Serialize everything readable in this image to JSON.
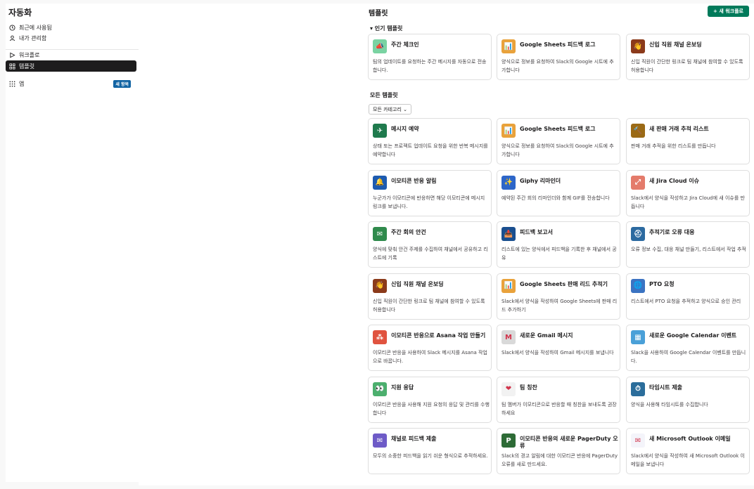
{
  "sidebar": {
    "title": "자동화",
    "recent_label": "최근에 사용됨",
    "managed_label": "내가 관리함",
    "workflows_label": "워크플로",
    "templates_label": "템플릿",
    "apps_label": "앱",
    "new_badge": "새 항목"
  },
  "header": {
    "title": "템플릿",
    "new_workflow_label": "+ 새 워크플로"
  },
  "popular": {
    "heading": "▾ 인기 템플릿",
    "cards": [
      {
        "title": "주간 체크인",
        "desc": "팀의 업데이트를 요청하는 주간 메시지를 자동으로 전송합니다.",
        "icon": "megaphone-icon",
        "color": "#7ad3a2",
        "glyph": "📣"
      },
      {
        "title": "Google Sheets 피드백 로그",
        "desc": "양식으로 정보를 요청하여 Slack의 Google 시트에 추가합니다",
        "icon": "sheets-icon",
        "color": "#e9a23b",
        "glyph": "📊"
      },
      {
        "title": "신입 직원 채널 온보딩",
        "desc": "신입 직원이 간단한 링크로 팀 채널에 참여할 수 있도록 허용합니다",
        "icon": "wave-icon",
        "color": "#8b3a1a",
        "glyph": "👋"
      }
    ]
  },
  "all": {
    "heading": "모든 템플릿",
    "filter_label": "모든 카테고리 ⌄",
    "cards": [
      {
        "title": "메시지 예약",
        "desc": "상태 또는 프로젝트 업데이트 요청을 위한 반복 메시지를 예약합니다",
        "icon": "paper-plane-icon",
        "color": "#1f7a4d",
        "glyph": "✈"
      },
      {
        "title": "Google Sheets 피드백 로그",
        "desc": "양식으로 정보를 요청하여 Slack의 Google 시트에 추가합니다",
        "icon": "sheets-icon",
        "color": "#e9a23b",
        "glyph": "📊"
      },
      {
        "title": "새 판매 거래 추적 리스트",
        "desc": "판매 거래 추적을 위한 리스트를 만듭니다",
        "icon": "gavel-icon",
        "color": "#9b6a16",
        "glyph": "🔨"
      },
      {
        "title": "이모티콘 반응 알림",
        "desc": "누군가가 이모티콘에 반응하면 해당 이모티콘에 메시지 링크를 보냅니다.",
        "icon": "bell-icon",
        "color": "#1d5bb0",
        "glyph": "🔔"
      },
      {
        "title": "Giphy 리마인더",
        "desc": "예약된 주간 회의 리마인더와 함께 GIF를 전송합니다",
        "icon": "giphy-icon",
        "color": "#2d66c9",
        "glyph": "✨"
      },
      {
        "title": "새 Jira Cloud 이슈",
        "desc": "Slack에서 양식을 작성하고 Jira Cloud에 새 이슈를 만듭니다",
        "icon": "jira-icon",
        "color": "#e47b6b",
        "glyph": "⤢"
      },
      {
        "title": "주간 회의 안건",
        "desc": "양식에 맞춰 안건 주제를 수집하여 채널에서 공유하고 리스트에 기록",
        "icon": "note-icon",
        "color": "#2f8a4c",
        "glyph": "✉"
      },
      {
        "title": "피드백 보고서",
        "desc": "리스트에 있는 양식에서 피드백을 기록한 후 채널에서 공유",
        "icon": "inbox-icon",
        "color": "#1a4f8f",
        "glyph": "📥"
      },
      {
        "title": "추적기로 오류 대응",
        "desc": "오류 정보 수집, 대응 채널 만들기, 리스트에서 작업 추적",
        "icon": "lifebuoy-icon",
        "color": "#2c6aa0",
        "glyph": "⛑"
      },
      {
        "title": "신입 직원 채널 온보딩",
        "desc": "신입 직원이 간단한 링크로 팀 채널에 참여할 수 있도록 허용합니다",
        "icon": "wave-icon",
        "color": "#8b3a1a",
        "glyph": "👋"
      },
      {
        "title": "Google Sheets 판매 리드 추적기",
        "desc": "Slack에서 양식을 작성하여 Google Sheets에 판매 리드 추가하기",
        "icon": "sheets-icon",
        "color": "#e9a23b",
        "glyph": "📊"
      },
      {
        "title": "PTO 요청",
        "desc": "리스트에서 PTO 요청을 추적하고 양식으로 승인 관리",
        "icon": "globe-icon",
        "color": "#3b73c2",
        "glyph": "🌐"
      },
      {
        "title": "이모티콘 반응으로 Asana 작업 만들기",
        "desc": "이모티콘 반응을 사용하여 Slack 메시지를 Asana 작업으로 바꿉니다.",
        "icon": "asana-icon",
        "color": "#e0533f",
        "glyph": "⁂"
      },
      {
        "title": "새로운 Gmail 메시지",
        "desc": "Slack에서 양식을 작성하여 Gmail 메시지를 보냅니다",
        "icon": "gmail-icon",
        "color": "#d9d9d9",
        "glyph": "M"
      },
      {
        "title": "새로운 Google Calendar 이벤트",
        "desc": "Slack을 사용하여 Google Calendar 이벤트를 만듭니다.",
        "icon": "calendar-icon",
        "color": "#4aa0d8",
        "glyph": "▦"
      },
      {
        "title": "지원 응답",
        "desc": "이모티콘 반응을 사용해 지원 요청의 응답 및 관리를 수행합니다",
        "icon": "eyes-icon",
        "color": "#4caf6e",
        "glyph": "👀"
      },
      {
        "title": "팀 칭찬",
        "desc": "팀 멤버가 이모티콘으로 반응할 때 칭찬을 보내도록 권장하세요",
        "icon": "heart-icon",
        "color": "#f2f2f2",
        "glyph": "❤"
      },
      {
        "title": "타임시트 제출",
        "desc": "양식을 사용해 타임시트를 수집합니다",
        "icon": "timesheet-icon",
        "color": "#2b6d9b",
        "glyph": "⏱"
      },
      {
        "title": "채널로 피드백 제출",
        "desc": "모두의 소중한 피드백을 읽기 쉬운 형식으로 추적하세요.",
        "icon": "feedback-icon",
        "color": "#6e5bc7",
        "glyph": "✉"
      },
      {
        "title": "이모티콘 반응의 새로운 PagerDuty 오류",
        "desc": "Slack의 경고 알림에 대한 이모티콘 반응에 PagerDuty 오류를 새로 만드세요.",
        "icon": "pagerduty-icon",
        "color": "#2d6b36",
        "glyph": "P"
      },
      {
        "title": "새 Microsoft Outlook 이메일",
        "desc": "Slack에서 양식을 작성하여 새 Microsoft Outlook 이메일을 보냅니다",
        "icon": "outlook-icon",
        "color": "#f4f4fa",
        "glyph": "✉"
      }
    ]
  }
}
